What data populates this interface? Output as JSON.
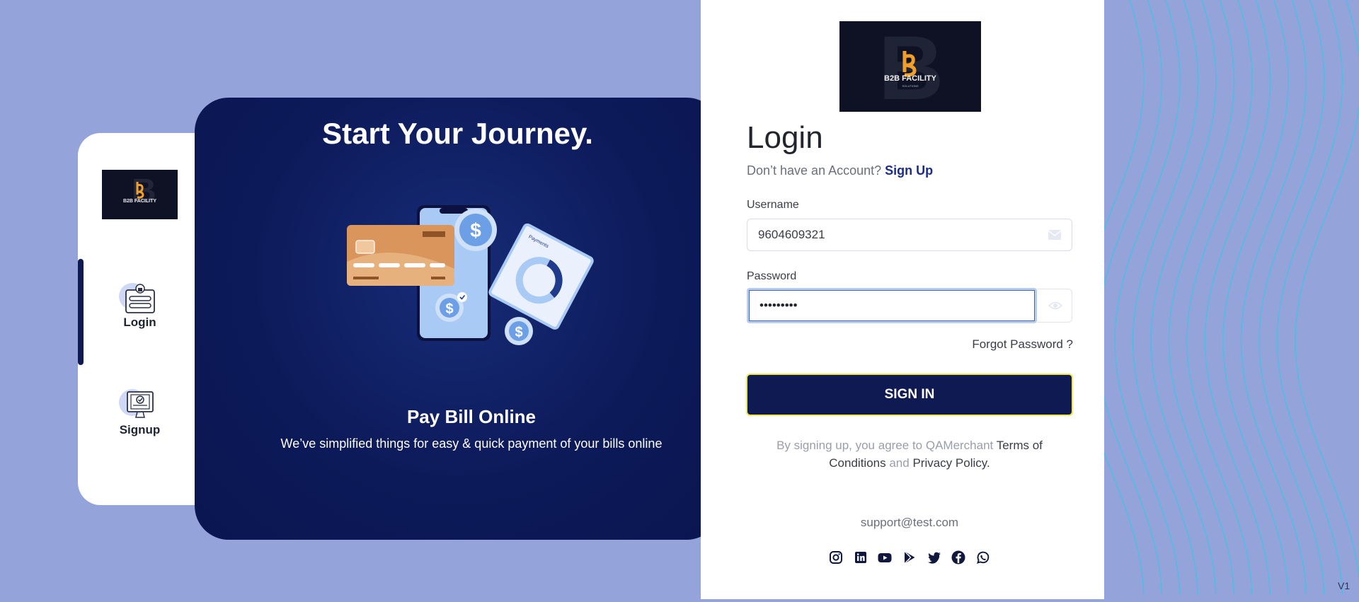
{
  "sidebar": {
    "items": [
      {
        "label": "Login"
      },
      {
        "label": "Signup"
      }
    ]
  },
  "brand": {
    "logo_text": "B2B FACILITY",
    "logo_subtext": "SOLUTIONS",
    "logo_letter": "B"
  },
  "hero": {
    "title": "Start Your Journey.",
    "subtitle": "Pay Bill Online",
    "description": "We’ve simplified things for easy & quick payment of your bills online",
    "illustration": {
      "currency_symbol": "$",
      "donut_label": "Payments"
    }
  },
  "form": {
    "title": "Login",
    "account_prompt": "Don’t have an Account?",
    "signup_link": "Sign Up",
    "username": {
      "label": "Username",
      "value": "9604609321",
      "icon": "envelope-icon"
    },
    "password": {
      "label": "Password",
      "masked_value": "•••••••••",
      "toggle_icon": "eye-icon"
    },
    "forgot_password": "Forgot Password ?",
    "submit_label": "SIGN IN",
    "terms": {
      "prefix": "By signing up, you agree to QAMerchant",
      "terms_link": "Terms of Conditions",
      "and": "and",
      "privacy_link": "Privacy Policy."
    },
    "support_email": "support@test.com",
    "socials": [
      "instagram-icon",
      "linkedin-icon",
      "youtube-icon",
      "google-play-icon",
      "twitter-icon",
      "facebook-icon",
      "whatsapp-icon"
    ]
  },
  "version": "V1",
  "colors": {
    "page_background": "#94a3d9",
    "navy": "#0f1a52",
    "link_blue": "#1b2c8a",
    "brand_orange": "#f0a02a",
    "signin_focus_border": "#f0e54a",
    "wave_line": "#3fc3e8"
  }
}
